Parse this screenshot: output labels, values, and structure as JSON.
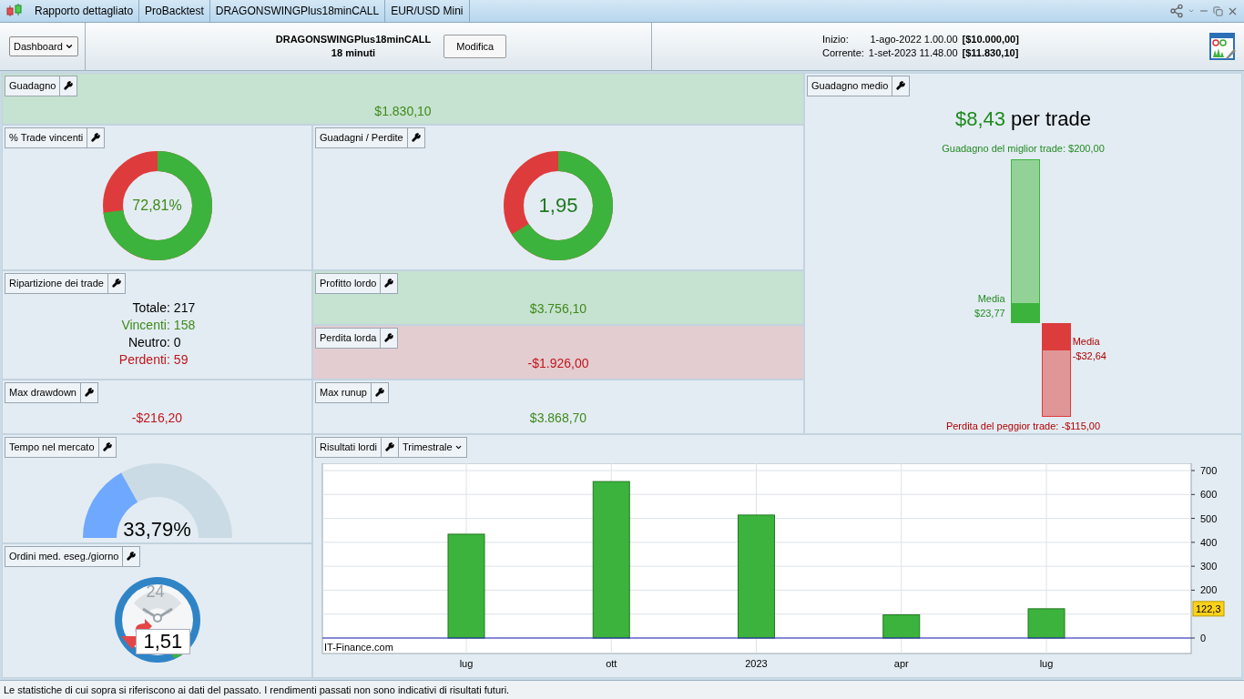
{
  "tabs": [
    {
      "label": "Rapporto dettagliato"
    },
    {
      "label": "ProBacktest"
    },
    {
      "label": "DRAGONSWINGPlus18minCALL"
    },
    {
      "label": "EUR/USD Mini"
    }
  ],
  "header": {
    "view_menu": "Dashboard",
    "strategy": "DRAGONSWINGPlus18minCALL",
    "timeframe": "18 minuti",
    "edit_button": "Modifica",
    "period": [
      {
        "label": "Inizio:",
        "date": "1-ago-2022 1.00.00",
        "equity": "[$10.000,00]"
      },
      {
        "label": "Corrente:",
        "date": "1-set-2023 11.48.00",
        "equity": "[$11.830,10]"
      }
    ]
  },
  "gain": {
    "title": "Guadagno",
    "value": "$1.830,10",
    "kind": "positive"
  },
  "win_rate": {
    "title": "% Trade vincenti",
    "value": "72,81%",
    "level": 0.7281
  },
  "win_loss": {
    "title": "Guadagni / Perdite",
    "value": "1,95",
    "level": 0.661
  },
  "breakdown": {
    "title": "Ripartizione dei trade",
    "rows": [
      {
        "kind": "total",
        "label": "Totale:",
        "value": "217"
      },
      {
        "kind": "win",
        "label": "Vincenti:",
        "value": "158"
      },
      {
        "kind": "neutral",
        "label": "Neutro:",
        "value": "0"
      },
      {
        "kind": "loss",
        "label": "Perdenti:",
        "value": "59"
      }
    ]
  },
  "gross_profit": {
    "title": "Profitto lordo",
    "value": "$3.756,10",
    "kind": "positive"
  },
  "gross_loss": {
    "title": "Perdita lorda",
    "value": "-$1.926,00",
    "kind": "negative"
  },
  "max_drawdown": {
    "title": "Max drawdown",
    "value": "-$216,20",
    "kind": "negative"
  },
  "max_runup": {
    "title": "Max runup",
    "value": "$3.868,70",
    "kind": "positive"
  },
  "time_in_market": {
    "title": "Tempo nel mercato",
    "value": "33,79%",
    "level": 0.3379
  },
  "orders_per_day": {
    "title": "Ordini med. eseg./giorno",
    "dial_label": "24",
    "value": "1,51"
  },
  "avg_gain": {
    "title": "Guadagno medio",
    "value": "$8,43",
    "suffix": "per trade",
    "best": {
      "label": "Guadagno del miglior trade: $200,00",
      "avg_label": "Media",
      "avg_value": "$23,77",
      "level": 0.119
    },
    "worst": {
      "label": "Perdita del peggior trade: -$115,00",
      "avg_label": "Media",
      "avg_value": "-$32,64",
      "level": 0.284
    }
  },
  "gross_results": {
    "title": "Risultati lordi",
    "period_menu": "Trimestrale",
    "credit": "IT-Finance.com",
    "chart_data": {
      "type": "bar",
      "categories": [
        "lug",
        "ott",
        "2023",
        "apr",
        "lug"
      ],
      "series": [
        {
          "color": "#3cb33c",
          "values": [
            434,
            654,
            514,
            97,
            122.3
          ]
        }
      ],
      "ylim": [
        0,
        700
      ],
      "yticks": [
        0,
        200,
        300,
        400,
        500,
        600,
        700
      ],
      "grid": true,
      "annotations": [
        "122,3"
      ]
    }
  },
  "status_bar": "Le statistiche di cui sopra si riferiscono ai dati del passato. I rendimenti passati non sono indicativi di risultati futuri."
}
